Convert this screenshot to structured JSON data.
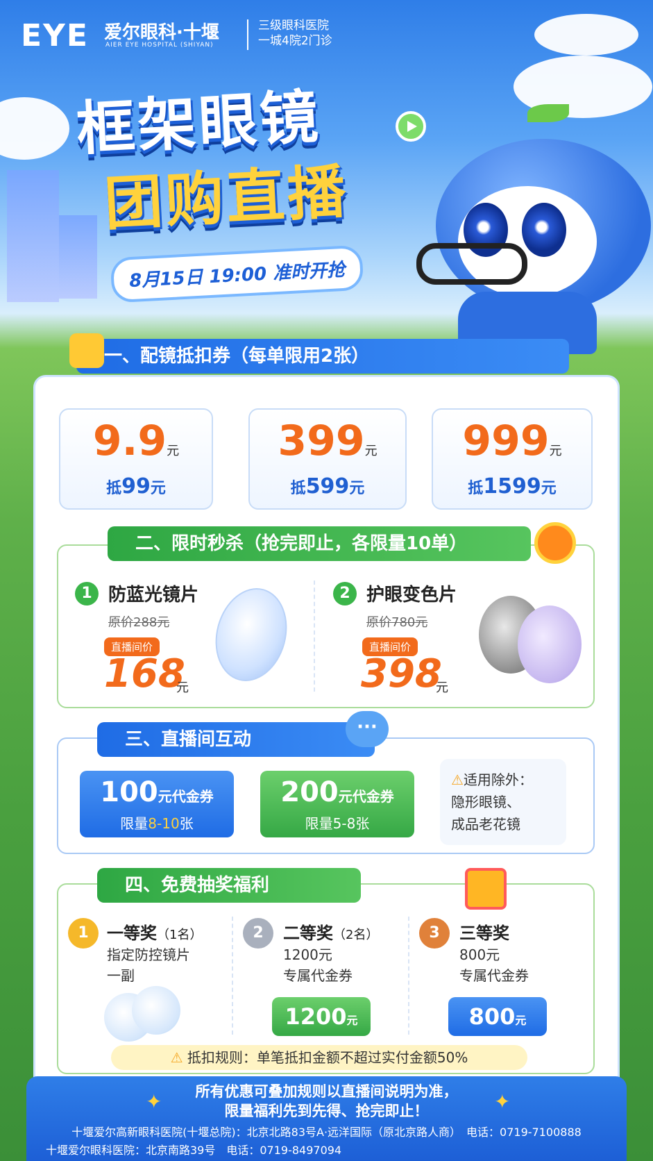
{
  "header": {
    "logo": "EYE",
    "hospital_cn": "爱尔眼科·十堰",
    "hospital_en": "AIER EYE HOSPITAL (SHIYAN)",
    "grade_line1": "三级眼科医院",
    "grade_line2": "一城4院2门诊"
  },
  "title": {
    "line1": "框架眼镜",
    "line2": "团购直播",
    "date": "8月15日 19:00 准时开抢"
  },
  "section1": {
    "heading": "一、配镜抵扣券（每单限用2张）",
    "coupons": [
      {
        "price": "9.9",
        "unit": "元",
        "deduct_prefix": "抵",
        "deduct": "99",
        "deduct_unit": "元"
      },
      {
        "price": "399",
        "unit": "元",
        "deduct_prefix": "抵",
        "deduct": "599",
        "deduct_unit": "元"
      },
      {
        "price": "999",
        "unit": "元",
        "deduct_prefix": "抵",
        "deduct": "1599",
        "deduct_unit": "元"
      }
    ]
  },
  "section2": {
    "heading": "二、限时秒杀（抢完即止，各限量10单）",
    "items": [
      {
        "num": "1",
        "name": "防蓝光镜片",
        "orig": "原价288元",
        "badge": "直播间价",
        "price": "168",
        "unit": "元"
      },
      {
        "num": "2",
        "name": "护眼变色片",
        "orig": "原价780元",
        "badge": "直播间价",
        "price": "398",
        "unit": "元"
      }
    ]
  },
  "section3": {
    "heading": "三、直播间互动",
    "vouchers": [
      {
        "amount": "100",
        "label": "元代金券",
        "limit_prefix": "限量",
        "limit": "8-10",
        "limit_suffix": "张",
        "color": "#2b78ea"
      },
      {
        "amount": "200",
        "label": "元代金券",
        "limit_prefix": "限量",
        "limit": "5-8",
        "limit_suffix": "张",
        "color": "#3bb54a"
      }
    ],
    "exclusion_title": "适用除外：",
    "exclusion_line1": "隐形眼镜、",
    "exclusion_line2": "成品老花镜"
  },
  "section4": {
    "heading": "四、免费抽奖福利",
    "prizes": [
      {
        "medal": "1",
        "title": "一等奖",
        "count": "（1名）",
        "line1": "指定防控镜片",
        "line2": "一副"
      },
      {
        "medal": "2",
        "title": "二等奖",
        "count": "（2名）",
        "line1": "1200元",
        "line2": "专属代金券",
        "ticket": "1200",
        "ticket_unit": "元"
      },
      {
        "medal": "3",
        "title": "三等奖",
        "count": "",
        "line1": "800元",
        "line2": "专属代金券",
        "ticket": "800",
        "ticket_unit": "元"
      }
    ],
    "rule": "抵扣规则：单笔抵扣金额不超过实付金额50%"
  },
  "footer": {
    "line1": "所有优惠可叠加规则以直播间说明为准，",
    "line2": "限量福利先到先得、抢完即止！",
    "address1": "十堰爱尔高新眼科医院(十堰总院)：北京北路83号A·远洋国际（原北京路人商）　电话：0719-7100888",
    "address2": "十堰爱尔眼科医院：北京南路39号　电话：0719-8497094"
  }
}
